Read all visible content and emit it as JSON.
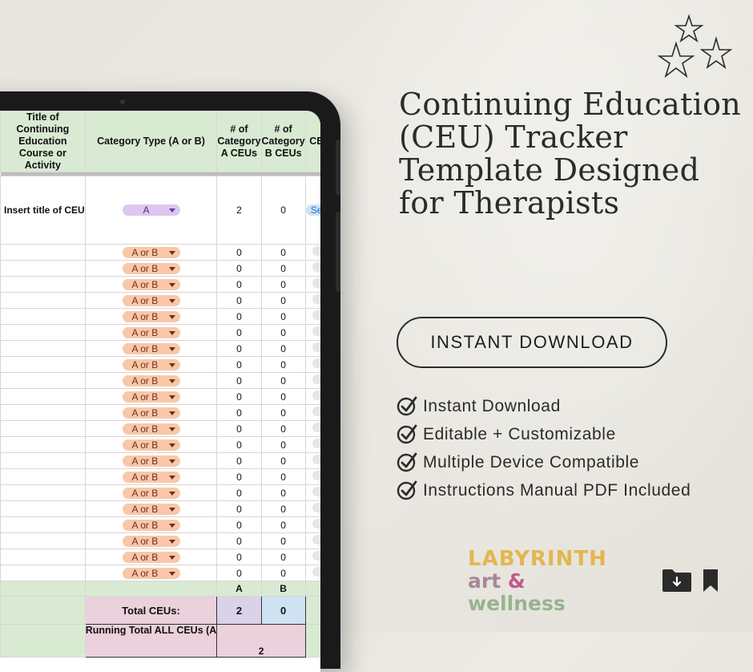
{
  "sheet": {
    "headers": [
      "Title of Continuing Education Course or Activity",
      "Category Type (A or B)",
      "# of Category A CEUs",
      "# of Category B CEUs",
      "CEU Pace"
    ],
    "first_row": {
      "title": "Insert title of CEU",
      "category": "A",
      "a": "2",
      "b": "0",
      "pace": "Selec"
    },
    "rows": [
      {
        "category": "A or B",
        "a": "0",
        "b": "0"
      },
      {
        "category": "A or B",
        "a": "0",
        "b": "0"
      },
      {
        "category": "A or B",
        "a": "0",
        "b": "0"
      },
      {
        "category": "A or B",
        "a": "0",
        "b": "0"
      },
      {
        "category": "A or B",
        "a": "0",
        "b": "0"
      },
      {
        "category": "A or B",
        "a": "0",
        "b": "0"
      },
      {
        "category": "A or B",
        "a": "0",
        "b": "0"
      },
      {
        "category": "A or B",
        "a": "0",
        "b": "0"
      },
      {
        "category": "A or B",
        "a": "0",
        "b": "0"
      },
      {
        "category": "A or B",
        "a": "0",
        "b": "0"
      },
      {
        "category": "A or B",
        "a": "0",
        "b": "0"
      },
      {
        "category": "A or B",
        "a": "0",
        "b": "0"
      },
      {
        "category": "A or B",
        "a": "0",
        "b": "0"
      },
      {
        "category": "A or B",
        "a": "0",
        "b": "0"
      },
      {
        "category": "A or B",
        "a": "0",
        "b": "0"
      },
      {
        "category": "A or B",
        "a": "0",
        "b": "0"
      },
      {
        "category": "A or B",
        "a": "0",
        "b": "0"
      },
      {
        "category": "A or B",
        "a": "0",
        "b": "0"
      },
      {
        "category": "A or B",
        "a": "0",
        "b": "0"
      },
      {
        "category": "A or B",
        "a": "0",
        "b": "0"
      },
      {
        "category": "A or B",
        "a": "0",
        "b": "0"
      }
    ],
    "col_a_label": "A",
    "col_b_label": "B",
    "total_label": "Total CEUs:",
    "total_a": "2",
    "total_b": "0",
    "running_label": "Running Total ALL CEUs (A",
    "running_value": "2"
  },
  "headline": "Continuing Education (CEU) Tracker Template Designed for Therapists",
  "download_button": "INSTANT DOWNLOAD",
  "features": [
    "Instant Download",
    "Editable + Customizable",
    "Multiple Device Compatible",
    "Instructions Manual PDF Included"
  ],
  "logo": {
    "top": "LABYRINTH",
    "art": "art",
    "amp": "&",
    "wellness": "wellness"
  },
  "icons": [
    "star-doodle-icon",
    "download-folder-icon",
    "bookmark-icon"
  ],
  "colors": {
    "header_green": "#d9ead3",
    "chip_purple": "#dcc7f0",
    "chip_orange": "#f8c8a8",
    "total_pink": "#ead1dc",
    "logo_gold": "#e4b64f",
    "logo_green": "#98b38f"
  }
}
